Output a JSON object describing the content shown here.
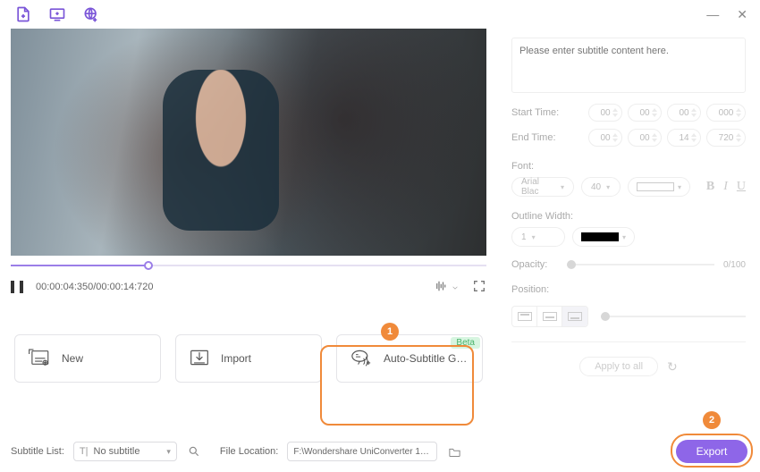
{
  "playback": {
    "current_time": "00:00:04:350",
    "total_time": "00:00:14:720"
  },
  "cards": {
    "new": "New",
    "import": "Import",
    "auto_sub": "Auto-Subtitle Generator",
    "beta": "Beta"
  },
  "steps": {
    "one": "1",
    "two": "2"
  },
  "bottom": {
    "subtitle_list_label": "Subtitle List:",
    "subtitle_list_value": "No subtitle",
    "file_location_label": "File Location:",
    "file_location_value": "F:\\Wondershare UniConverter 13\\SubEdi..."
  },
  "right": {
    "placeholder": "Please enter subtitle content here.",
    "start_label": "Start Time:",
    "end_label": "End Time:",
    "start": [
      "00",
      "00",
      "00",
      "000"
    ],
    "end": [
      "00",
      "00",
      "14",
      "720"
    ],
    "font_label": "Font:",
    "font_name": "Arial Blac",
    "font_size": "40",
    "outline_label": "Outline Width:",
    "outline_val": "1",
    "opacity_label": "Opacity:",
    "opacity_val": "0/100",
    "position_label": "Position:",
    "apply_all": "Apply to all",
    "export": "Export"
  }
}
